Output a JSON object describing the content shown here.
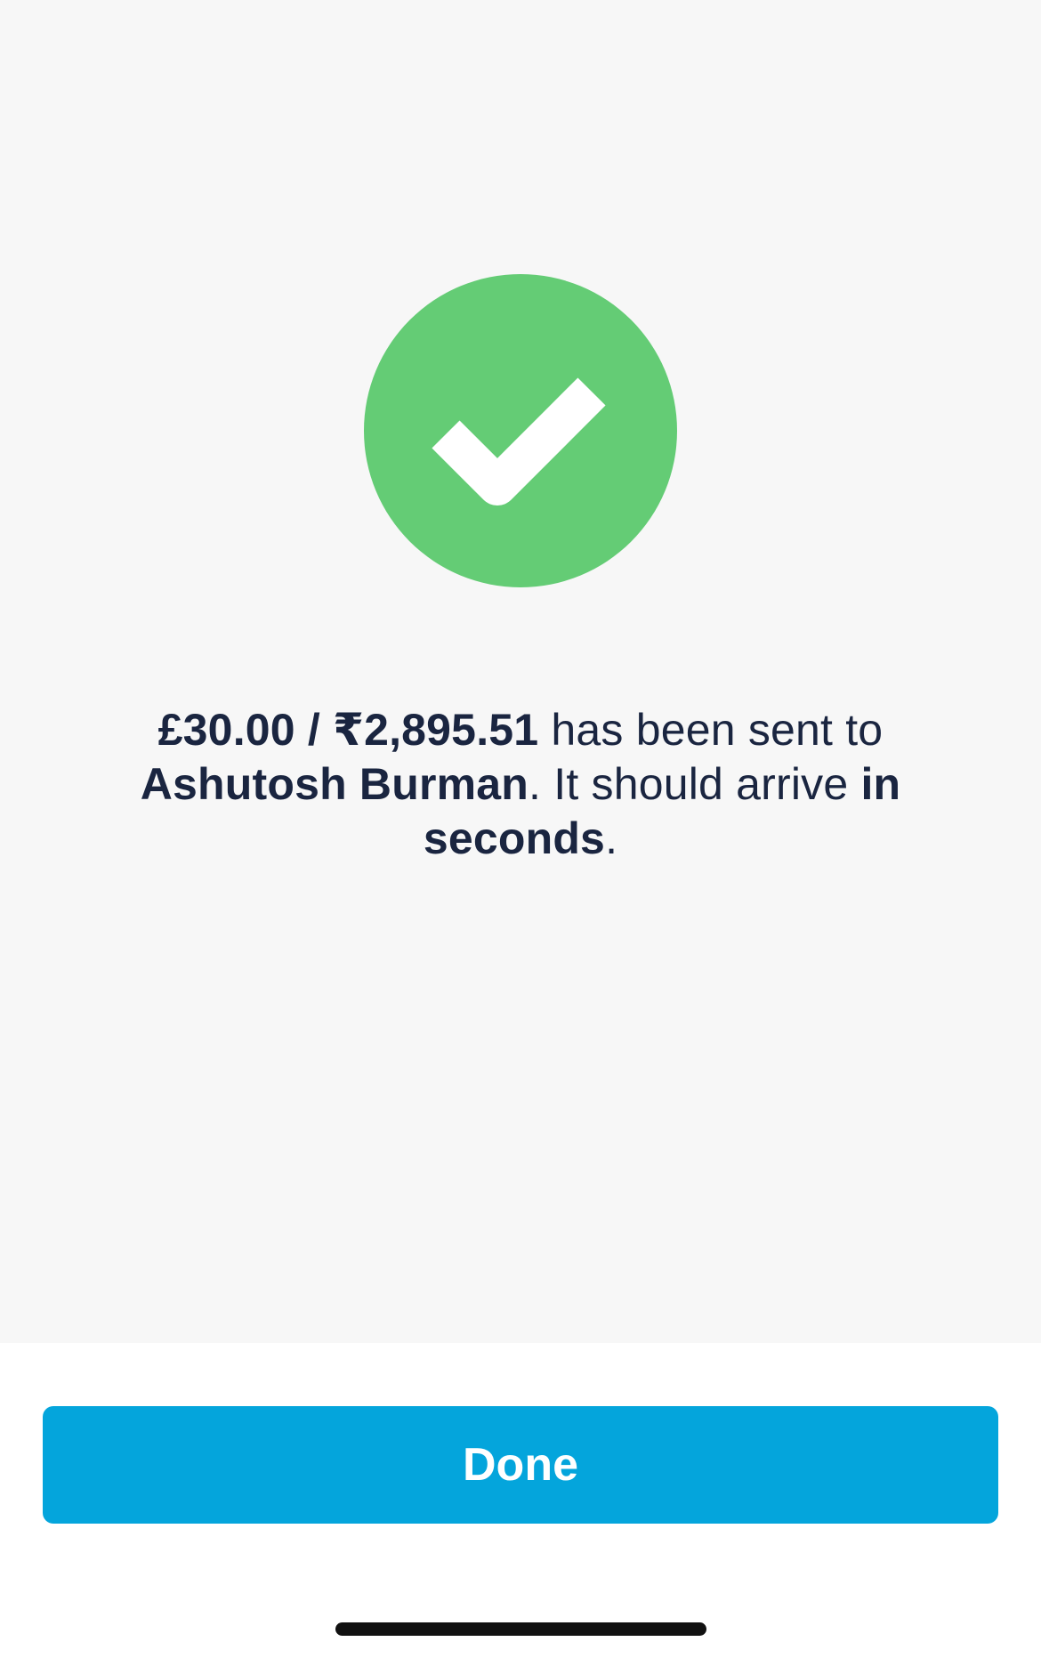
{
  "confirmation": {
    "icon": "checkmark-icon",
    "icon_color": "#64cc75",
    "amount": "£30.00 / ₹2,895.51",
    "text_sent_to": " has been sent to ",
    "recipient": "Ashutosh Burman",
    "text_arrival": ". It should arrive ",
    "arrival_time": "in seconds",
    "period": "."
  },
  "actions": {
    "done_label": "Done",
    "done_color": "#04a5dc"
  }
}
